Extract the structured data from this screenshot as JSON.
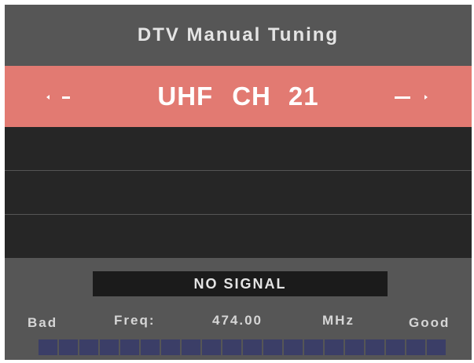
{
  "screen": {
    "title": "DTV Manual Tuning"
  },
  "channel": {
    "band": "UHF",
    "prefix": "CH",
    "number": "21"
  },
  "status": {
    "signal_text": "NO SIGNAL"
  },
  "meter": {
    "bad_label": "Bad",
    "good_label": "Good",
    "freq_label": "Freq:",
    "freq_value": "474.00",
    "freq_unit": "MHz",
    "segments_total": 20,
    "segments_lit": 0
  },
  "colors": {
    "frame_bg": "#565656",
    "highlight_row": "#e27a72",
    "info_rows": "#262626",
    "signal_box": "#1b1b1b",
    "meter_empty": "#3b3e67"
  },
  "icons": {
    "left": "arrow-left-icon",
    "right": "arrow-right-icon"
  }
}
